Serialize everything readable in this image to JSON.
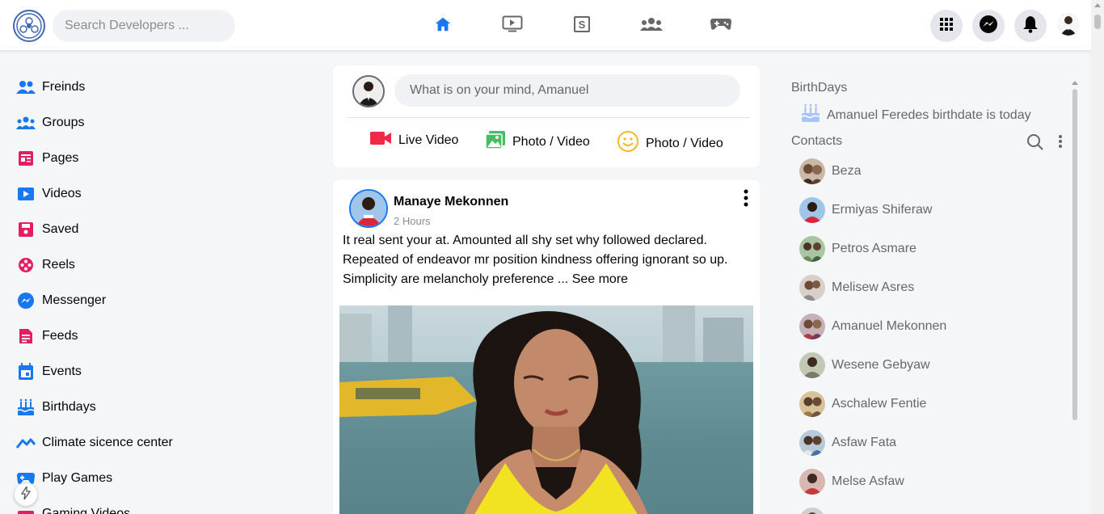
{
  "header": {
    "search_placeholder": "Search Developers ...",
    "nav": [
      {
        "icon": "home-icon",
        "active": true
      },
      {
        "icon": "video-icon",
        "active": false
      },
      {
        "icon": "marketplace-icon",
        "active": false
      },
      {
        "icon": "groups-icon",
        "active": false
      },
      {
        "icon": "gaming-icon",
        "active": false
      }
    ],
    "accent": "#1877f2"
  },
  "sidebar": {
    "items": [
      {
        "label": "Freinds",
        "icon": "friends-icon"
      },
      {
        "label": "Groups",
        "icon": "groups-icon"
      },
      {
        "label": "Pages",
        "icon": "pages-icon"
      },
      {
        "label": "Videos",
        "icon": "videos-icon"
      },
      {
        "label": "Saved",
        "icon": "saved-icon"
      },
      {
        "label": "Reels",
        "icon": "reels-icon"
      },
      {
        "label": "Messenger",
        "icon": "messenger-icon"
      },
      {
        "label": "Feeds",
        "icon": "feeds-icon"
      },
      {
        "label": "Events",
        "icon": "events-icon"
      },
      {
        "label": "Birthdays",
        "icon": "birthdays-icon"
      },
      {
        "label": "Climate sicence center",
        "icon": "climate-icon"
      },
      {
        "label": "Play Games",
        "icon": "games-icon"
      },
      {
        "label": "Gaming Videos",
        "icon": "gaming-videos-icon"
      }
    ]
  },
  "composer": {
    "placeholder": "What is on your mind, Amanuel",
    "actions": [
      {
        "label": "Live Video",
        "icon": "live-video-icon"
      },
      {
        "label": "Photo / Video",
        "icon": "photo-icon"
      },
      {
        "label": "Photo / Video",
        "icon": "feeling-icon"
      }
    ]
  },
  "post": {
    "author": "Manaye Mekonnen",
    "time": "2 Hours",
    "text": "It real sent your at. Amounted all shy set why followed declared. Repeated of endeavor mr position kindness offering ignorant so up. Simplicity are melancholy preference ...",
    "see_more": "See more"
  },
  "right": {
    "birthdays_title": "BirthDays",
    "birthday_text": "Amanuel Feredes birthdate is today",
    "contacts_title": "Contacts",
    "contacts": [
      {
        "name": "Beza"
      },
      {
        "name": "Ermiyas Shiferaw"
      },
      {
        "name": "Petros Asmare"
      },
      {
        "name": "Melisew Asres"
      },
      {
        "name": "Amanuel Mekonnen"
      },
      {
        "name": "Wesene Gebyaw"
      },
      {
        "name": "Aschalew Fentie"
      },
      {
        "name": "Asfaw Fata"
      },
      {
        "name": "Melse Asfaw"
      },
      {
        "name": ""
      }
    ]
  }
}
